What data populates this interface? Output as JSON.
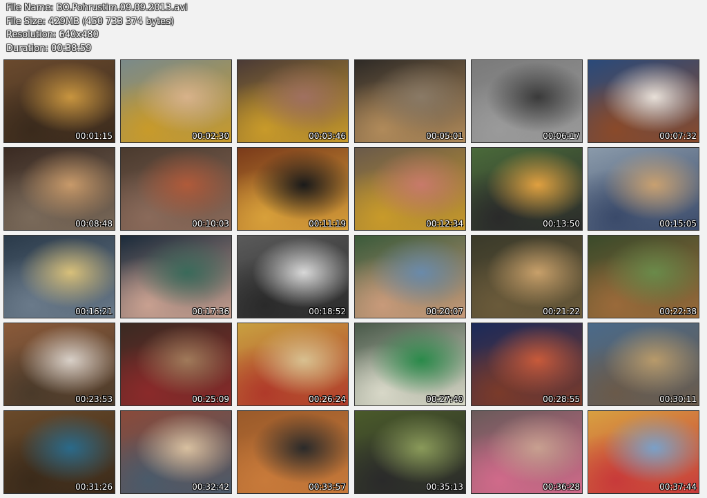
{
  "header": {
    "file_name": "File Name: BO.Pohrustim.09.09.2013.avi",
    "file_size": "File Size: 429MB (450 733 374 bytes)",
    "resolution": "Resolution: 640x480",
    "duration": "Duration: 00:38:59"
  },
  "thumbnails": [
    {
      "time": "00:01:15",
      "colors": [
        "#6a4a2e",
        "#c8953f",
        "#3a2a1c"
      ]
    },
    {
      "time": "00:02:30",
      "colors": [
        "#7a8a8a",
        "#d8b28a",
        "#c89a2a"
      ]
    },
    {
      "time": "00:03:46",
      "colors": [
        "#4a3a36",
        "#a07060",
        "#c89a2a"
      ]
    },
    {
      "time": "00:05:01",
      "colors": [
        "#2e2a26",
        "#8a7a66",
        "#b08a5a"
      ]
    },
    {
      "time": "00:06:17",
      "colors": [
        "#7a7a7a",
        "#3a3a3a",
        "#9a9a9a"
      ]
    },
    {
      "time": "00:07:32",
      "colors": [
        "#2a4a7a",
        "#e8e0d8",
        "#8a4a2a"
      ]
    },
    {
      "time": "00:08:48",
      "colors": [
        "#3a2a22",
        "#c89a6a",
        "#7a6a5a"
      ]
    },
    {
      "time": "00:10:03",
      "colors": [
        "#4a3a2e",
        "#b05a3a",
        "#8a6a5a"
      ]
    },
    {
      "time": "00:11:19",
      "colors": [
        "#7a3a1a",
        "#1a1a1a",
        "#d8a03a"
      ]
    },
    {
      "time": "00:12:34",
      "colors": [
        "#6a5a4a",
        "#c87a6a",
        "#c89a2a"
      ]
    },
    {
      "time": "00:13:50",
      "colors": [
        "#4a6a3a",
        "#e0a040",
        "#2a2a2a"
      ]
    },
    {
      "time": "00:15:05",
      "colors": [
        "#8a9aaa",
        "#c8a070",
        "#3a4a6a"
      ]
    },
    {
      "time": "00:16:21",
      "colors": [
        "#2a3a4a",
        "#d8c07a",
        "#6a7a8a"
      ]
    },
    {
      "time": "00:17:36",
      "colors": [
        "#1a2a3a",
        "#3a6a5a",
        "#c8a090"
      ]
    },
    {
      "time": "00:18:52",
      "colors": [
        "#5a5a5a",
        "#d8d8d8",
        "#2a2a2a"
      ]
    },
    {
      "time": "00:20:07",
      "colors": [
        "#3a5a3a",
        "#6a8aaa",
        "#c89a7a"
      ]
    },
    {
      "time": "00:21:22",
      "colors": [
        "#3a3a2a",
        "#c8a06a",
        "#6a5a3a"
      ]
    },
    {
      "time": "00:22:38",
      "colors": [
        "#3a4a2a",
        "#6a8a4a",
        "#9a6a3a"
      ]
    },
    {
      "time": "00:23:53",
      "colors": [
        "#8a5a3a",
        "#d8d0c8",
        "#4a3a2a"
      ]
    },
    {
      "time": "00:25:09",
      "colors": [
        "#3a2a22",
        "#a07a5a",
        "#8a2a2a"
      ]
    },
    {
      "time": "00:26:24",
      "colors": [
        "#c8a040",
        "#d8c090",
        "#b03a2a"
      ]
    },
    {
      "time": "00:27:40",
      "colors": [
        "#4a5a4a",
        "#2a8a4a",
        "#d8d8c8"
      ]
    },
    {
      "time": "00:28:55",
      "colors": [
        "#1a2a5a",
        "#c85a3a",
        "#7a3a2a"
      ]
    },
    {
      "time": "00:30:11",
      "colors": [
        "#4a6a8a",
        "#b89a6a",
        "#6a5a4a"
      ]
    },
    {
      "time": "00:31:26",
      "colors": [
        "#6a4a2a",
        "#2a6a8a",
        "#3a2a1a"
      ]
    },
    {
      "time": "00:32:42",
      "colors": [
        "#8a4a3a",
        "#d8c0a0",
        "#4a5a6a"
      ]
    },
    {
      "time": "00:33:57",
      "colors": [
        "#9a5a2a",
        "#2a2a2a",
        "#c87a3a"
      ]
    },
    {
      "time": "00:35:13",
      "colors": [
        "#4a5a2a",
        "#8a9a5a",
        "#2a2a2a"
      ]
    },
    {
      "time": "00:36:28",
      "colors": [
        "#6a5a5a",
        "#c8a090",
        "#d06a8a"
      ]
    },
    {
      "time": "00:37:44",
      "colors": [
        "#d8a040",
        "#7aa0c8",
        "#c83a3a"
      ]
    }
  ]
}
